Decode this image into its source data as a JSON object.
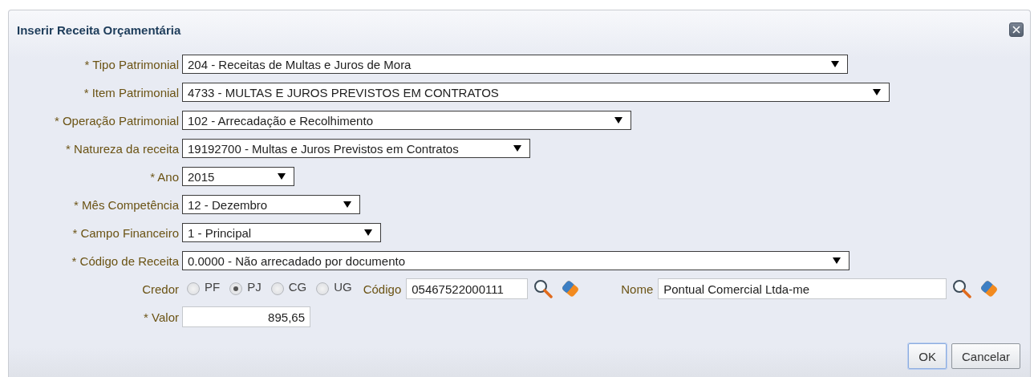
{
  "dialog": {
    "title": "Inserir Receita Orçamentária"
  },
  "fields": [
    {
      "label": "* Tipo Patrimonial",
      "value": "204 - Receitas de Multas e Juros de Mora"
    },
    {
      "label": "* Item Patrimonial",
      "value": "4733 - MULTAS E JUROS PREVISTOS EM CONTRATOS"
    },
    {
      "label": "* Operação Patrimonial",
      "value": "102 - Arrecadação e Recolhimento"
    },
    {
      "label": "* Natureza da receita",
      "value": "19192700 - Multas e Juros Previstos em Contratos"
    },
    {
      "label": "* Ano",
      "value": "2015"
    },
    {
      "label": "* Mês Competência",
      "value": "12 - Dezembro"
    },
    {
      "label": "* Campo Financeiro",
      "value": "1 - Principal"
    },
    {
      "label": "* Código de Receita",
      "value": "0.0000 - Não arrecadado por documento"
    }
  ],
  "credor": {
    "label": "Credor",
    "options": [
      {
        "label": "PF",
        "selected": false
      },
      {
        "label": "PJ",
        "selected": true
      },
      {
        "label": "CG",
        "selected": false
      },
      {
        "label": "UG",
        "selected": false
      }
    ],
    "codigo_label": "Código",
    "codigo_value": "05467522000111",
    "nome_label": "Nome",
    "nome_value": "Pontual Comercial Ltda-me"
  },
  "valor": {
    "label": "* Valor",
    "value": "895,65"
  },
  "buttons": [
    "OK",
    "Cancelar"
  ]
}
